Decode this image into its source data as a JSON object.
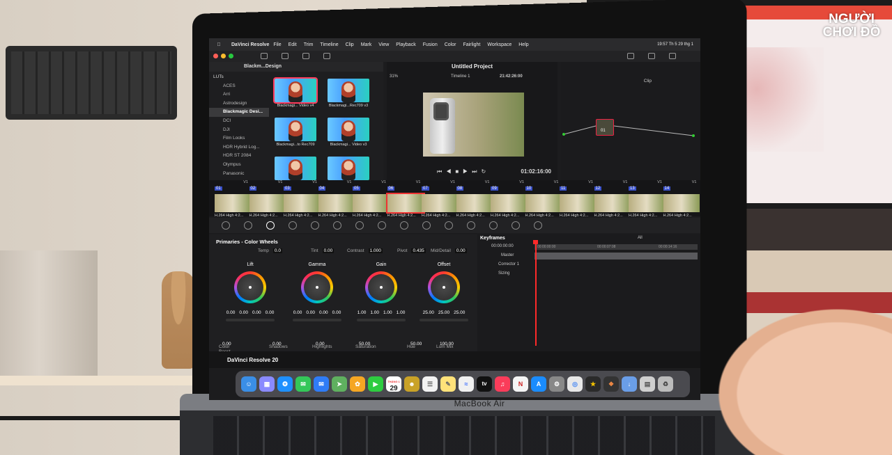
{
  "watermark": {
    "line1": "NGƯỜI",
    "line2": "CHƠI ĐỒ"
  },
  "laptop": {
    "brand": "MacBook Air"
  },
  "menubar": {
    "app_name": "DaVinci Resolve",
    "items": [
      "File",
      "Edit",
      "Trim",
      "Timeline",
      "Clip",
      "Mark",
      "View",
      "Playback",
      "Fusion",
      "Color",
      "Fairlight",
      "Workspace",
      "Help"
    ],
    "clock": "19:57 Th 5 29 thg 1"
  },
  "media": {
    "path": "Blackm...Design",
    "zoom": "31%",
    "luts": [
      {
        "label": "LUTs",
        "root": true
      },
      {
        "label": "ACES"
      },
      {
        "label": "Arri"
      },
      {
        "label": "Astrodesign"
      },
      {
        "label": "Blackmagic Desi...",
        "selected": true
      },
      {
        "label": "DCI"
      },
      {
        "label": "DJI"
      },
      {
        "label": "Film Looks"
      },
      {
        "label": "HDR Hybrid Log..."
      },
      {
        "label": "HDR ST 2084"
      },
      {
        "label": "Olympus"
      },
      {
        "label": "Panasonic"
      }
    ],
    "thumbnails": [
      {
        "caption": "Blackmagi... Video v4",
        "selected": true
      },
      {
        "caption": "Blackmagi...Rec709 v3"
      },
      {
        "caption": "Blackmagi...to Rec709"
      },
      {
        "caption": "Blackmagi... Video v3"
      },
      {
        "caption": ""
      },
      {
        "caption": ""
      }
    ]
  },
  "viewer": {
    "project_title": "Untitled Project",
    "timeline_name": "Timeline 1",
    "timecode_top": "21:42:26:00",
    "timecode": "01:02:16:00",
    "clip_label": "Clip"
  },
  "nodes": {
    "node_label": "01"
  },
  "clips": [
    {
      "num": "01",
      "track": "V1",
      "caption": "H.264 High 4:2..."
    },
    {
      "num": "02",
      "track": "V1",
      "caption": "H.264 High 4:2..."
    },
    {
      "num": "03",
      "track": "V1",
      "caption": "H.264 High 4:2..."
    },
    {
      "num": "04",
      "track": "V1",
      "caption": "H.264 High 4:2..."
    },
    {
      "num": "05",
      "track": "V1",
      "caption": "H.264 High 4:2..."
    },
    {
      "num": "06",
      "track": "V1",
      "caption": "H.264 High 4:2...",
      "selected": true
    },
    {
      "num": "07",
      "track": "V1",
      "caption": "H.264 High 4:2..."
    },
    {
      "num": "08",
      "track": "V1",
      "caption": "H.264 High 4:2..."
    },
    {
      "num": "09",
      "track": "V1",
      "caption": "H.264 High 4:2..."
    },
    {
      "num": "10",
      "track": "V1",
      "caption": "H.264 High 4:2..."
    },
    {
      "num": "11",
      "track": "V1",
      "caption": "H.264 High 4:2..."
    },
    {
      "num": "12",
      "track": "V1",
      "caption": "H.264 High 4:2..."
    },
    {
      "num": "13",
      "track": "V1",
      "caption": "H.264 High 4:2..."
    },
    {
      "num": "14",
      "track": "V1",
      "caption": "H.264 High 4:2..."
    }
  ],
  "primaries": {
    "title": "Primaries - Color Wheels",
    "temp": {
      "label": "Temp",
      "value": "0.0"
    },
    "tint": {
      "label": "Tint",
      "value": "0.00"
    },
    "contrast": {
      "label": "Contrast",
      "value": "1.000"
    },
    "pivot": {
      "label": "Pivot",
      "value": "0.435"
    },
    "middetail": {
      "label": "Mid/Detail",
      "value": "0.00"
    },
    "wheels": [
      {
        "label": "Lift",
        "values": [
          "0.00",
          "0.00",
          "0.00",
          "0.00"
        ]
      },
      {
        "label": "Gamma",
        "values": [
          "0.00",
          "0.00",
          "0.00",
          "0.00"
        ]
      },
      {
        "label": "Gain",
        "values": [
          "1.00",
          "1.00",
          "1.00",
          "1.00"
        ]
      },
      {
        "label": "Offset",
        "values": [
          "25.00",
          "25.00",
          "25.00"
        ]
      }
    ],
    "color_boost": {
      "label": "Color Boost",
      "value": "0.00"
    },
    "shadows": {
      "label": "Shadows",
      "value": "0.00"
    },
    "highlights": {
      "label": "Highlights",
      "value": "0.00"
    },
    "saturation": {
      "label": "Saturation",
      "value": "50.00"
    },
    "hue": {
      "label": "Hue",
      "value": "50.00"
    },
    "lummix": {
      "label": "Lum Mix",
      "value": "100.00"
    }
  },
  "keyframes": {
    "title": "Keyframes",
    "filter": "All",
    "time": "00:00:00:00",
    "ruler": [
      "00:00:00:00",
      "00:00:07:08",
      "00:00:14:16"
    ],
    "rows": [
      "Master",
      "Corrector 1",
      "Sizing"
    ]
  },
  "pagebar": {
    "app_badge": "DaVinci Resolve 20"
  },
  "dock": {
    "calendar_month": "THÁNG 1",
    "calendar_day": "29",
    "tv_label": "tv"
  },
  "colors": {
    "accent_red": "#ff2a2a",
    "clip_number_blue": "#3950c9",
    "panel_bg": "#1f1f21"
  }
}
